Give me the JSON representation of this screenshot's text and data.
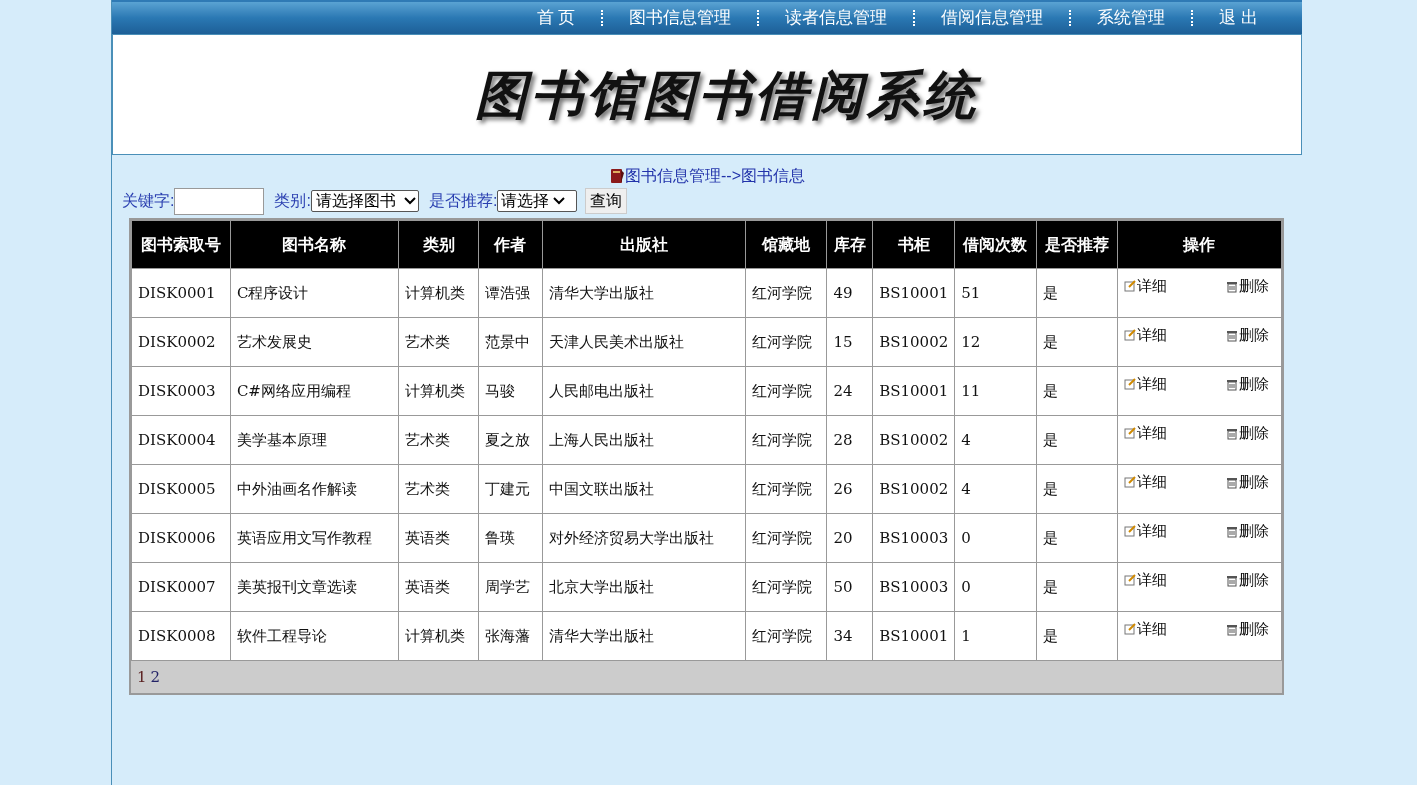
{
  "nav": [
    "首 页",
    "图书信息管理",
    "读者信息管理",
    "借阅信息管理",
    "系统管理",
    "退 出"
  ],
  "banner_title": "图书馆图书借阅系统",
  "breadcrumb": "图书信息管理-->图书信息",
  "search": {
    "keyword_label": "关键字:",
    "category_label": "类别:",
    "category_value": "请选择图书",
    "recommend_label": "是否推荐:",
    "recommend_value": "请选择",
    "button": "查询"
  },
  "table": {
    "columns": [
      "图书索取号",
      "图书名称",
      "类别",
      "作者",
      "出版社",
      "馆藏地",
      "库存",
      "书柜",
      "借阅次数",
      "是否推荐",
      "操作"
    ],
    "rows": [
      {
        "cells": [
          "DISK0001",
          "C程序设计",
          "计算机类",
          "谭浩强",
          "清华大学出版社",
          "红河学院",
          "49",
          "BS10001",
          "51",
          "是"
        ],
        "actions": [
          "详细",
          "删除"
        ]
      },
      {
        "cells": [
          "DISK0002",
          "艺术发展史",
          "艺术类",
          "范景中",
          "天津人民美术出版社",
          "红河学院",
          "15",
          "BS10002",
          "12",
          "是"
        ],
        "actions": [
          "详细",
          "删除"
        ]
      },
      {
        "cells": [
          "DISK0003",
          "C#网络应用编程",
          "计算机类",
          "马骏",
          "人民邮电出版社",
          "红河学院",
          "24",
          "BS10001",
          "11",
          "是"
        ],
        "actions": [
          "详细",
          "删除"
        ]
      },
      {
        "cells": [
          "DISK0004",
          "美学基本原理",
          "艺术类",
          "夏之放",
          "上海人民出版社",
          "红河学院",
          "28",
          "BS10002",
          "4",
          "是"
        ],
        "actions": [
          "详细",
          "删除"
        ]
      },
      {
        "cells": [
          "DISK0005",
          "中外油画名作解读",
          "艺术类",
          "丁建元",
          "中国文联出版社",
          "红河学院",
          "26",
          "BS10002",
          "4",
          "是"
        ],
        "actions": [
          "详细",
          "删除"
        ]
      },
      {
        "cells": [
          "DISK0006",
          "英语应用文写作教程",
          "英语类",
          "鲁瑛",
          "对外经济贸易大学出版社",
          "红河学院",
          "20",
          "BS10003",
          "0",
          "是"
        ],
        "actions": [
          "详细",
          "删除"
        ]
      },
      {
        "cells": [
          "DISK0007",
          "美英报刊文章选读",
          "英语类",
          "周学艺",
          "北京大学出版社",
          "红河学院",
          "50",
          "BS10003",
          "0",
          "是"
        ],
        "actions": [
          "详细",
          "删除"
        ]
      },
      {
        "cells": [
          "DISK0008",
          "软件工程导论",
          "计算机类",
          "张海藩",
          "清华大学出版社",
          "红河学院",
          "34",
          "BS10001",
          "1",
          "是"
        ],
        "actions": [
          "详细",
          "删除"
        ]
      }
    ]
  },
  "pagination": [
    {
      "label": "1",
      "selected": true
    },
    {
      "label": "2",
      "selected": false
    }
  ]
}
